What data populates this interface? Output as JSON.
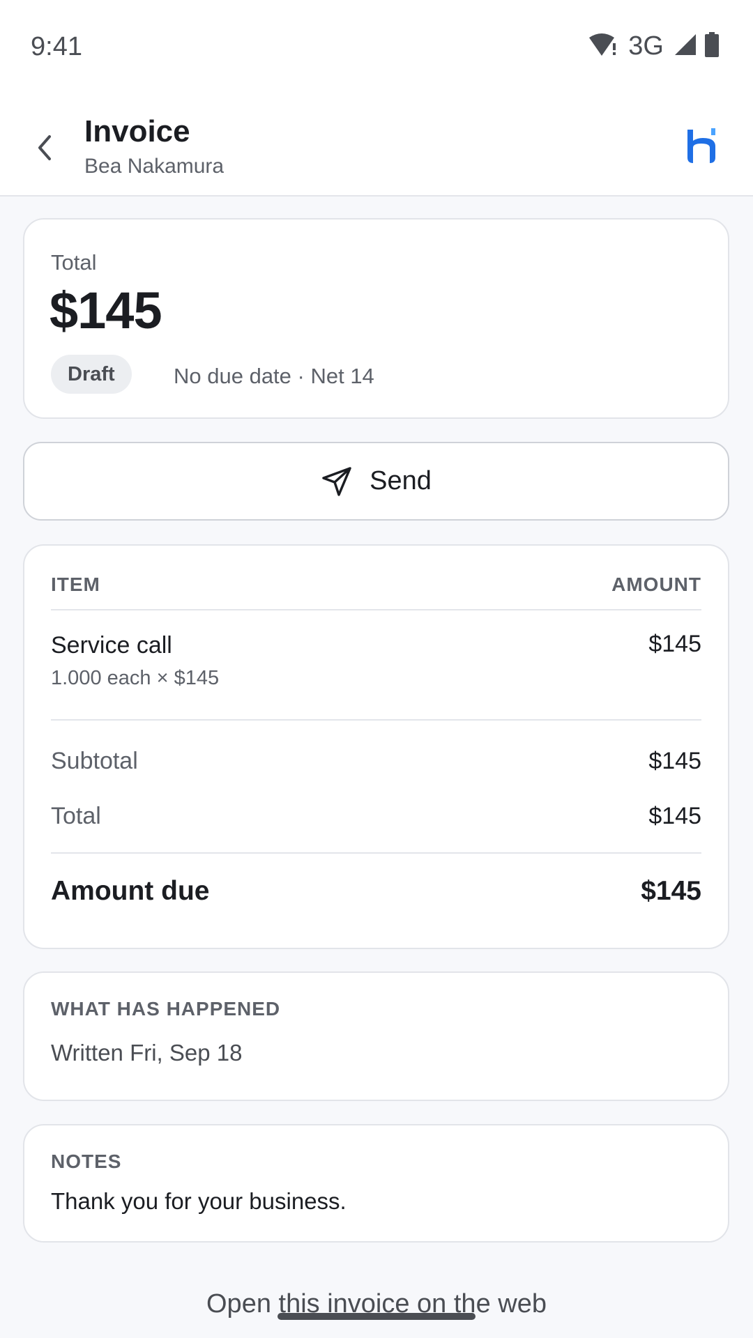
{
  "status_bar": {
    "time": "9:41",
    "network": "3G",
    "icons": [
      "wifi-alert-icon",
      "cell-signal-icon",
      "battery-icon"
    ]
  },
  "header": {
    "back_icon": "chevron-left-icon",
    "title": "Invoice",
    "subtitle": "Bea Nakamura",
    "logo_icon": "brand-logo-icon",
    "logo_color": "#1f6fe5"
  },
  "summary": {
    "total_label": "Total",
    "total_amount": "$145",
    "status": "Draft",
    "due_text": "No due date · Net 14"
  },
  "send_button": {
    "label": "Send",
    "icon": "send-icon"
  },
  "line_items": {
    "columns": [
      "ITEM",
      "AMOUNT"
    ],
    "rows": [
      {
        "name": "Service call",
        "detail": "1.000 each × $145",
        "amount": "$145"
      }
    ],
    "subtotal_label": "Subtotal",
    "subtotal_value": "$145",
    "total_label": "Total",
    "total_value": "$145",
    "amount_due_label": "Amount due",
    "amount_due_value": "$145"
  },
  "history": {
    "heading": "WHAT HAS HAPPENED",
    "entries": [
      "Written Fri, Sep 18"
    ]
  },
  "notes": {
    "heading": "NOTES",
    "text": "Thank you for your business."
  },
  "footer": {
    "web_link": "Open this invoice on the web"
  }
}
